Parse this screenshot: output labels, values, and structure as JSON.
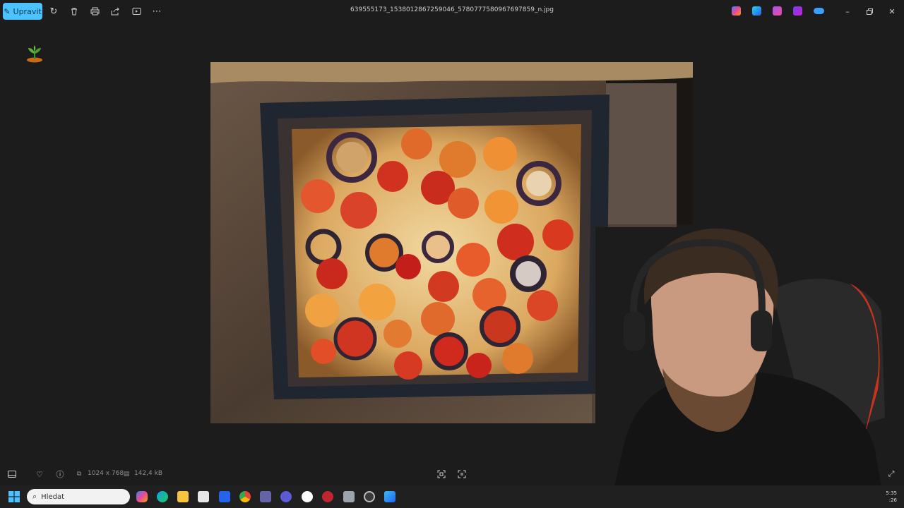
{
  "toolbar": {
    "edit_label": "Upravit",
    "filename": "639555173_1538012867259046_5780777580967697859_n.jpg"
  },
  "status": {
    "dimensions": "1024 x 768",
    "filesize": "142,4 kB"
  },
  "taskbar": {
    "search_placeholder": "Hledat",
    "time": "5:35",
    "date": ":26"
  },
  "colors": {
    "accent": "#4cc2ff",
    "background": "#1c1c1c",
    "taskbar": "#202020"
  }
}
